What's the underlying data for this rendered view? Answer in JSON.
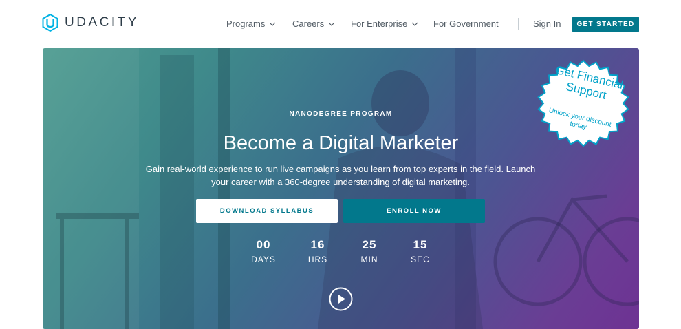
{
  "brand": {
    "name": "UDACITY",
    "accent": "#02788c",
    "badge_color": "#02a2c9"
  },
  "nav": {
    "items": [
      {
        "label": "Programs",
        "has_dropdown": true
      },
      {
        "label": "Careers",
        "has_dropdown": true
      },
      {
        "label": "For Enterprise",
        "has_dropdown": true
      },
      {
        "label": "For Government",
        "has_dropdown": false
      }
    ],
    "sign_in": "Sign In",
    "cta": "GET STARTED"
  },
  "hero": {
    "kicker": "NANODEGREE PROGRAM",
    "title": "Become a Digital Marketer",
    "subtitle": "Gain real-world experience to run live campaigns as you learn from top experts in the field. Launch your career with a 360-degree understanding of digital marketing.",
    "download_label": "DOWNLOAD SYLLABUS",
    "enroll_label": "ENROLL NOW",
    "countdown": [
      {
        "value": "00",
        "label": "DAYS"
      },
      {
        "value": "16",
        "label": "HRS"
      },
      {
        "value": "25",
        "label": "MIN"
      },
      {
        "value": "15",
        "label": "SEC"
      }
    ],
    "play_icon": "play-circle-icon"
  },
  "badge": {
    "headline": "Get Financial Support",
    "subline": "Unlock your discount today"
  }
}
